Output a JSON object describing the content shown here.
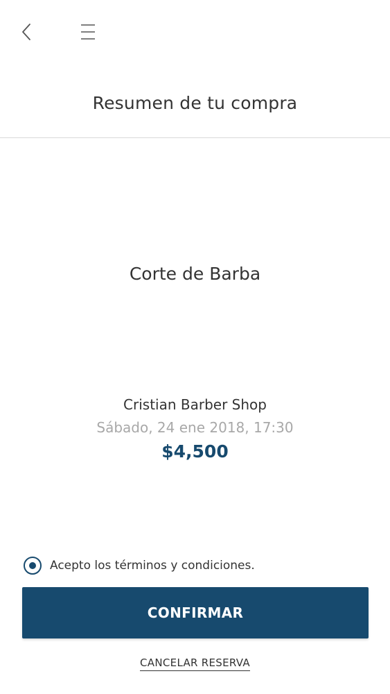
{
  "header": {
    "back_icon": "chevron-left-icon",
    "menu_icon": "hamburger-menu-icon",
    "title": "Resumen de tu compra"
  },
  "summary": {
    "service": "Corte de Barba",
    "shop": "Cristian Barber Shop",
    "datetime": "Sábado, 24 ene 2018, 17:30",
    "price": "$4,500"
  },
  "terms": {
    "label": "Acepto los términos y condiciones.",
    "checked": true
  },
  "actions": {
    "confirm_label": "CONFIRMAR",
    "cancel_label": "CANCELAR RESERVA"
  },
  "colors": {
    "accent": "#174a6e",
    "muted_text": "#a8a8a8",
    "divider": "#d8d8d8"
  }
}
